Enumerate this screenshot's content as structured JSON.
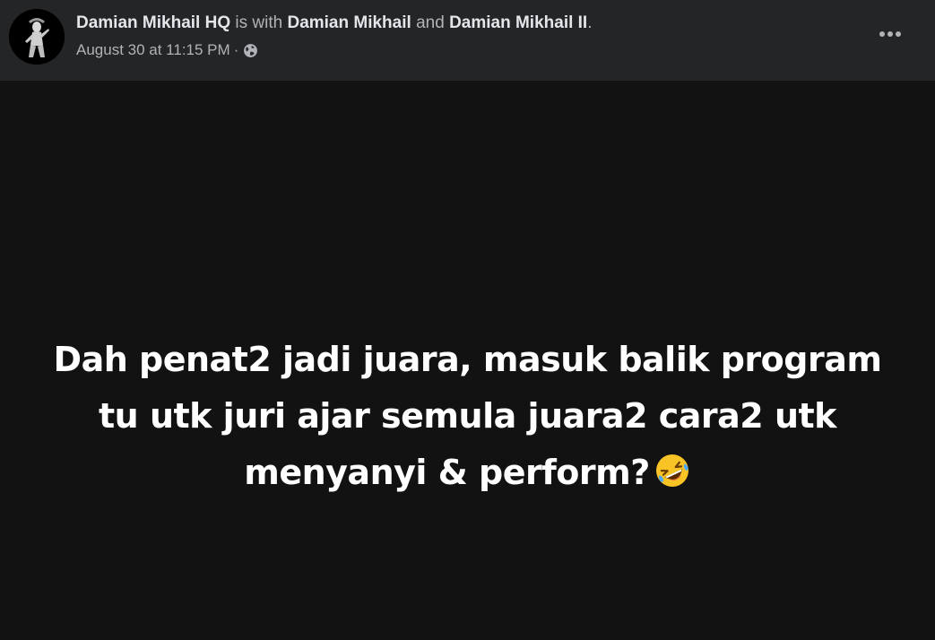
{
  "post": {
    "author": "Damian Mikhail HQ",
    "with_text": " is with ",
    "tagged_1": "Damian Mikhail",
    "and_text": " and ",
    "tagged_2": "Damian Mikhail II",
    "period": ".",
    "timestamp": "August 30 at 11:15 PM",
    "separator": "·",
    "privacy_icon": "globe-icon",
    "more_icon": "more-options-icon",
    "text_lines": [
      "Dah penat2 jadi juara, masuk balik program",
      "tu utk juri ajar semula juara2 cara2 utk",
      "menyanyi & perform?"
    ],
    "emoji": "rolling-on-floor-laughing-emoji"
  },
  "colors": {
    "header_bg": "#242526",
    "content_bg": "#121212",
    "primary_text": "#e4e6eb",
    "secondary_text": "#b0b3b8",
    "post_text": "#ffffff"
  }
}
